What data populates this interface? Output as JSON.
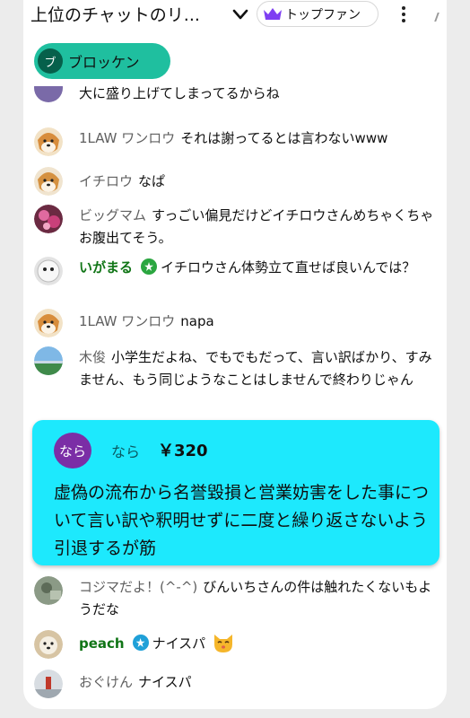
{
  "header": {
    "title": "上位のチャットのリ...",
    "topfan_label": "トップファン"
  },
  "pinned": {
    "avatar_letter": "ブ",
    "name": "ブロッケン"
  },
  "messages": [
    {
      "author": "",
      "text": "大に盛り上げてしまってるからね"
    },
    {
      "author": "1LAW ワンロウ",
      "text": "それは謝ってるとは言わないwww"
    },
    {
      "author": "イチロウ",
      "text": "なぱ"
    },
    {
      "author": "ビッグマム",
      "text": "すっごい偏見だけどイチロウさんめちゃくちゃお腹出てそう。"
    },
    {
      "author": "いがまる",
      "text": "イチロウさん体勢立て直せば良いんでは？"
    },
    {
      "author": "1LAW ワンロウ",
      "text": "napa"
    },
    {
      "author": "木俊",
      "text": "小学生だよね、でもでもだって、言い訳ばかり、すみません、もう同じようなことはしませんで終わりじゃん"
    },
    {
      "author": "コジマだよ！(^-^)",
      "text": "びんいちさんの件は触れたくないもようだな"
    },
    {
      "author": "peach",
      "text": "ナイスパ"
    },
    {
      "author": "おぐけん",
      "text": "ナイスパ"
    }
  ],
  "superchat": {
    "avatar_letter": "なら",
    "author": "なら",
    "amount": "￥320",
    "text": "虚偽の流布から名誉毀損と営業妨害をした事について言い訳や釈明せずに二度と繰り返さないよう引退するが筋"
  },
  "colors": {
    "superchat_bg": "#1de9fd",
    "member_name": "#107516",
    "pin_chip": "#1fbf9f",
    "crown": "#7e3ff2"
  }
}
